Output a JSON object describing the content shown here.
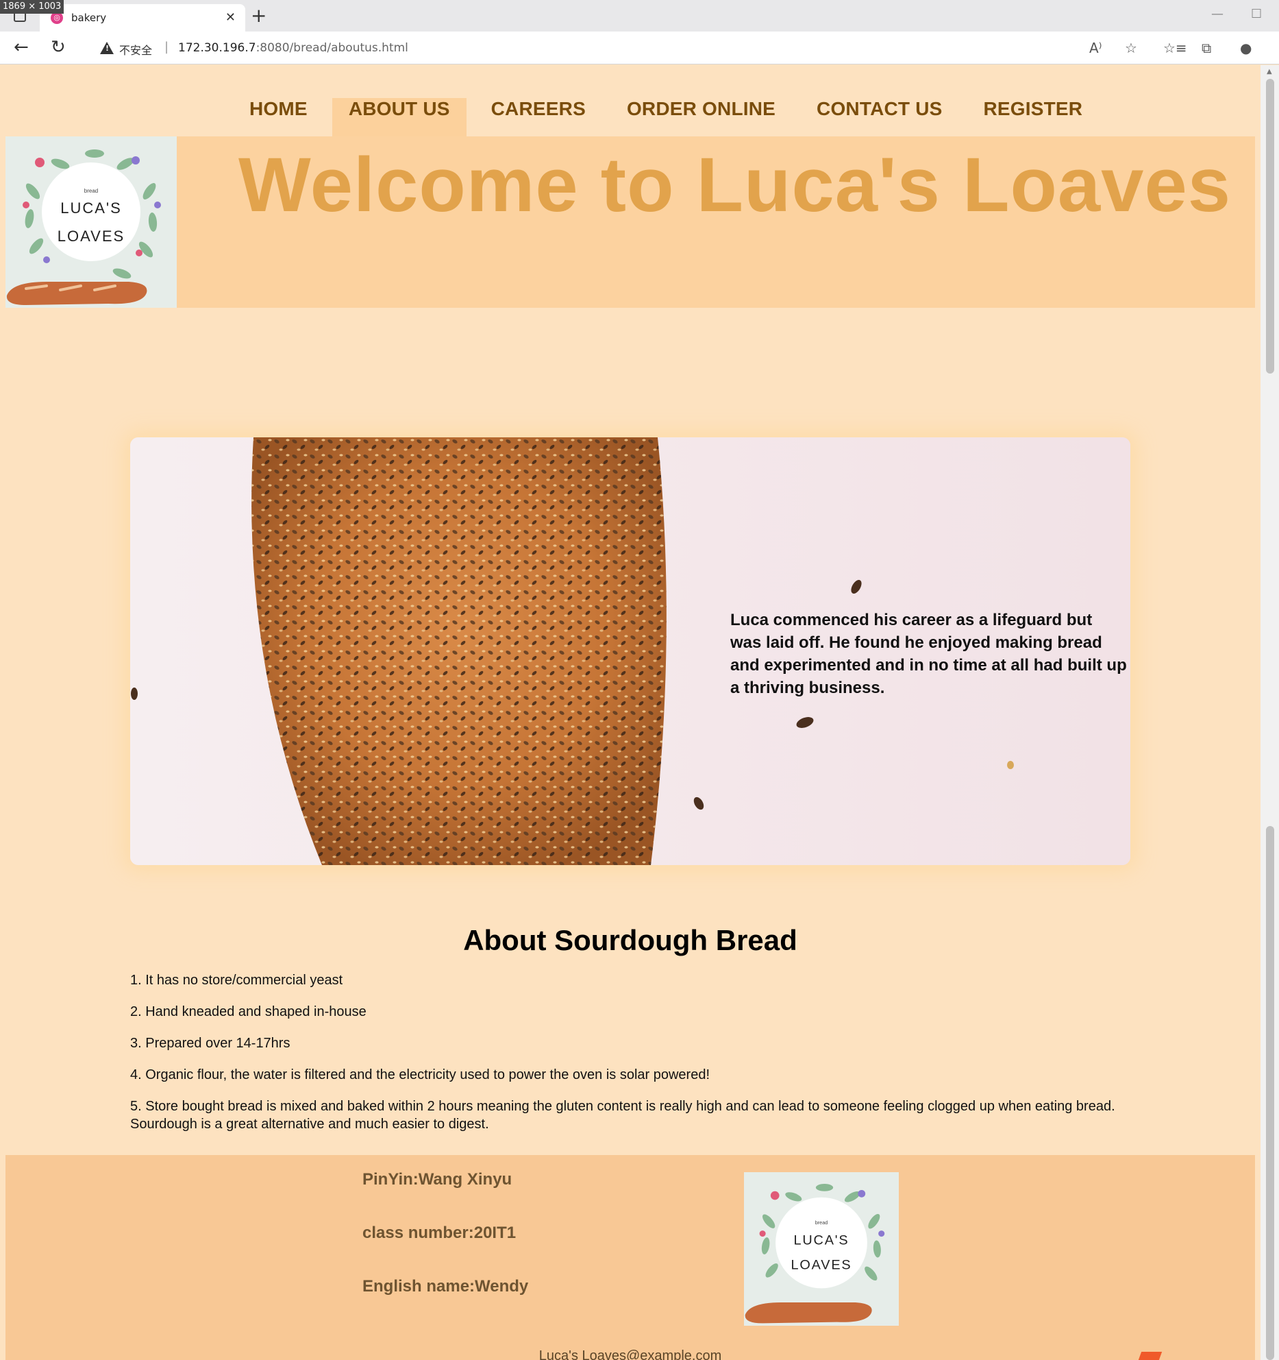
{
  "browser": {
    "dims_badge": "1869 × 1003",
    "tab_title": "bakery",
    "security_text": "不安全",
    "url_host": "172.30.196.7",
    "url_rest": ":8080/bread/aboutus.html"
  },
  "nav": {
    "items": [
      "HOME",
      "ABOUT US",
      "CAREERS",
      "ORDER ONLINE",
      "CONTACT US",
      "REGISTER"
    ],
    "active": "ABOUT US"
  },
  "header": {
    "title": "Welcome to Luca's Loaves",
    "logo": {
      "small": "bread",
      "line1": "LUCA'S",
      "line2": "LOAVES"
    }
  },
  "hero": {
    "text": "Luca commenced his career as a lifeguard but was laid off. He found he enjoyed making bread and experimented and in no time at all had built up a thriving business."
  },
  "about": {
    "title": "About Sourdough Bread",
    "items": [
      "1. It has no store/commercial yeast",
      "2. Hand kneaded and shaped in-house",
      "3. Prepared over 14-17hrs",
      "4. Organic flour, the water is filtered and the electricity used to power the oven is solar powered!",
      "5. Store bought bread is mixed and baked within 2 hours meaning the gluten content is really high and can lead to someone feeling clogged up when eating bread. Sourdough is a great alternative and much easier to digest."
    ]
  },
  "footer": {
    "pinyin": "PinYin:Wang Xinyu",
    "class_number": "class number:20IT1",
    "english_name": "English name:Wendy",
    "email": "Luca's Loaves@example.com"
  },
  "colors": {
    "page_bg": "#fde2c0",
    "header_band": "#fcd29f",
    "nav_text": "#7a4d0c",
    "welcome_text": "#e2a34c",
    "footer_bg": "#f8c895"
  }
}
